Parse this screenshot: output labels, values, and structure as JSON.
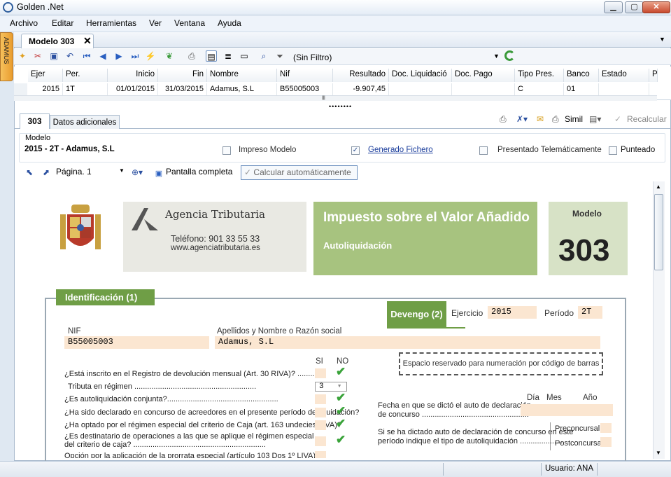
{
  "window": {
    "title": "Golden .Net",
    "min": "▁",
    "max": "▢",
    "close": "✕"
  },
  "menu": [
    "Archivo",
    "Editar",
    "Herramientas",
    "Ver",
    "Ventana",
    "Ayuda"
  ],
  "side_tab": "ADAMUS",
  "doc_tab": {
    "label": "Modelo 303",
    "close": "✕"
  },
  "toolbar": {
    "filter": "(Sin Filtro)"
  },
  "grid": {
    "headers": [
      "Ejer",
      "Per.",
      "Inicio",
      "Fin",
      "Nombre",
      "Nif",
      "Resultado",
      "Doc. Liquidació",
      "Doc. Pago",
      "Tipo Pres.",
      "Banco",
      "Estado",
      "P"
    ],
    "row": [
      "2015",
      "1T",
      "01/01/2015",
      "31/03/2015",
      "Adamus, S.L",
      "B55005003",
      "-9.907,45",
      "",
      "",
      "C",
      "01",
      "",
      ""
    ]
  },
  "inner_tabs": {
    "tab1": "303",
    "tab2": "Datos adicionales",
    "simil": "Simil",
    "recalc": "Recalcular"
  },
  "model": {
    "group_label": "Modelo",
    "value": "2015 - 2T - Adamus, S.L",
    "impreso": "Impreso Modelo",
    "generado": "Generado Fichero",
    "presentado": "Presentado Telemáticamente",
    "punteado": "Punteado",
    "impreso_checked": false,
    "generado_checked": true,
    "presentado_checked": false,
    "punteado_checked": false
  },
  "viewer": {
    "page": "Página. 1",
    "fullscreen": "Pantalla completa",
    "autocalc": "Calcular automáticamente"
  },
  "form": {
    "agency_name": "Agencia Tributaria",
    "agency_tel": "Teléfono: 901 33 55 33",
    "agency_web": "www.agenciatributaria.es",
    "iva_title": "Impuesto sobre el Valor Añadido",
    "iva_sub": "Autoliquidación",
    "modelo_label": "Modelo",
    "modelo_num": "303",
    "ident_tab": "Identificación (1)",
    "devengo_tab": "Devengo (2)",
    "ejercicio_label": "Ejercicio",
    "ejercicio": "2015",
    "periodo_label": "Período",
    "periodo": "2T",
    "nif_label": "NIF",
    "nif": "B55005003",
    "nombre_label": "Apellidos y Nombre o Razón social",
    "nombre": "Adamus, S.L",
    "si": "SI",
    "no": "NO",
    "barcode": "Espacio reservado para numeración por código de barras",
    "q1": "¿Está inscrito en el Registro de devolución mensual (Art. 30 RIVA)? ...........",
    "q2": "Tributa en régimen .........................................................",
    "q2_value": "3",
    "q3": "¿Es autoliquidación conjunta?....................................................",
    "q4": "¿Ha sido declarado en concurso de acreedores en el presente período de liquidación?",
    "q5": "¿Ha optado por el régimen especial del criterio de Caja (art. 163 undecies LIVA)?",
    "q6a": "¿Es destinatario de operaciones a las que se aplique el régimen especial",
    "q6b": "del criterio de caja? ..............................................................",
    "q7": "Opción por la aplicación de la prorrata especial (artículo 103 Dos 1º LIVA)",
    "dia": "Día",
    "mes": "Mes",
    "anio": "Año",
    "fecha_a": "Fecha en que se dictó el auto de declaración",
    "fecha_b": "de concurso ..................................................",
    "auto_a": "Si se ha dictado auto de declaración de concurso en este",
    "auto_b": "período indique el tipo de autoliquidación ....................",
    "preconcursal": "Preconcursal",
    "postconcursal": "Postconcursal"
  },
  "status": {
    "user": "Usuario: ANA"
  }
}
